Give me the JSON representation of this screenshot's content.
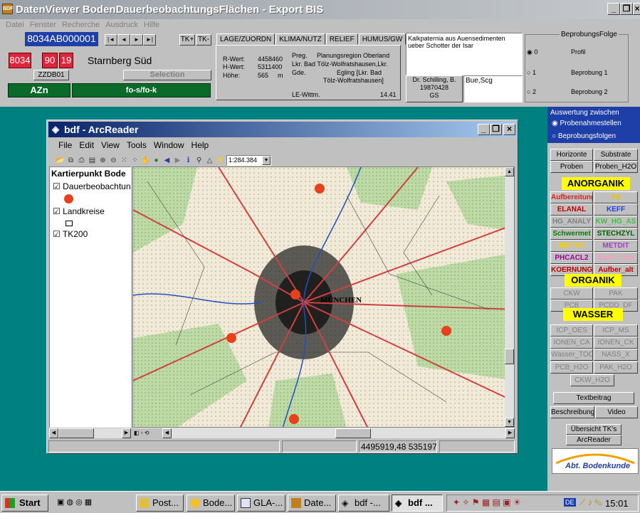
{
  "app": {
    "title": "DatenViewer BodenDauerbeobachtungsFlächen - Export BIS",
    "menu": [
      "Datei",
      "Fenster",
      "Recherche",
      "Ausdruck",
      "Hilfe"
    ]
  },
  "record": {
    "id": "8034AB000001",
    "nav_buttons": [
      "|◄",
      "◄",
      "►",
      "►|"
    ],
    "tk_plus": "TK+",
    "tk_minus": "TK-",
    "code1": "8034",
    "code2": "90",
    "code3": "19",
    "name": "Starnberg Süd",
    "zzdb": "ZZDB01",
    "selection_label": "Selection",
    "azn_label": "AZn",
    "fo_label": "fo-s/fo-k"
  },
  "tabs": [
    "LAGE/ZUORDN",
    "KLIMA/NUTZ",
    "RELIEF",
    "HUMUS/GW"
  ],
  "lage": {
    "rwert_label": "R-Wert:",
    "rwert": "4458460",
    "hwert_label": "H-Wert:",
    "hwert": "5311400",
    "hoehe_label": "Höhe:",
    "hoehe": "565",
    "hoehe_unit": "m",
    "preg_label": "Preg.",
    "preg": "Planungsregion Oberland",
    "lkr_label": "Lkr.",
    "lkr": "Bad Tölz-Wolfratshausen,Lkr.",
    "gde_label": "Gde.",
    "gde_line1": "Egling [Lkr. Bad",
    "gde_line2": "Tölz-Wolfratshausen]",
    "lewittm_label": "LE-Wittm.",
    "lewittm": "14.41"
  },
  "note": {
    "text": "Kalkpaternia aus Auensedimenten ueber Schotter der Isar",
    "person": "Dr. Schilling, B.",
    "date": "19870428",
    "gs": "GS",
    "abbr": "Bue,Scg"
  },
  "beprobung": {
    "group_label": "BeprobungsFolge",
    "options": [
      {
        "radio": "0",
        "label": "Profil",
        "selected": true
      },
      {
        "radio": "1",
        "label": "Beprobung 1",
        "selected": false
      },
      {
        "radio": "2",
        "label": "Beprobung 2",
        "selected": false
      }
    ]
  },
  "arcreader": {
    "title": "bdf - ArcReader",
    "menu": [
      "File",
      "Edit",
      "View",
      "Tools",
      "Window",
      "Help"
    ],
    "scale": "1:284.384",
    "toc_title": "Kartierpunkt Bode",
    "layers": [
      {
        "label": "Dauerbeobachtun",
        "checked": true
      },
      {
        "label": "Landkreise",
        "checked": true
      },
      {
        "label": "TK200",
        "checked": true
      }
    ],
    "map_label": "MÜNCHEN",
    "coords": "4495919,48  535197",
    "points_color": "#e8401c"
  },
  "auswertung": {
    "group_label": "Auswertung zwischen",
    "options": [
      {
        "label": "Probenahmestellen",
        "selected": true
      },
      {
        "label": "Beprobungsfolgen",
        "selected": false
      }
    ]
  },
  "right": {
    "row1": [
      "Horizonte",
      "Substrate"
    ],
    "row2": [
      "Proben",
      "Proben_H2O"
    ],
    "anorganik": "ANORGANIK",
    "anorg_buttons": [
      {
        "label": "Aufbereitung",
        "color": "#e02020"
      },
      {
        "label": "AS",
        "color": "#f0c000"
      },
      {
        "label": "ELANAL",
        "color": "#c00000"
      },
      {
        "label": "KEFF",
        "color": "#2040e0"
      },
      {
        "label": "HG_ANALY",
        "color": "#808080"
      },
      {
        "label": "KW_HG_AS",
        "color": "#40c040"
      },
      {
        "label": "Schwermet",
        "color": "#008000"
      },
      {
        "label": "STECHZYL",
        "color": "#006000"
      },
      {
        "label": "METOX",
        "color": "#f0d000"
      },
      {
        "label": "METDIT",
        "color": "#a040c0"
      },
      {
        "label": "PHCACL2",
        "color": "#a000a0"
      },
      {
        "label": "Radio_Nuk",
        "color": "#f0a0c0"
      },
      {
        "label": "KOERNUNG",
        "color": "#c00000"
      },
      {
        "label": "Aufber_alt",
        "color": "#c00000"
      }
    ],
    "organik": "ORGANIK",
    "org_buttons": [
      "CKW",
      "PAK",
      "PCB",
      "PCDD_DF"
    ],
    "wasser": "WASSER",
    "wasser_buttons": [
      "ICP_OES",
      "ICP_MS",
      "IONEN_CA",
      "IONEN_CK",
      "Wasser_TOC",
      "NASS_X"
    ],
    "h2o_buttons": [
      "PCB_H2O",
      "PAK_H2O"
    ],
    "ckw_h2o": "CKW_H2O",
    "textbeitrag": "Textbeitrag",
    "beschreibung": "Beschreibung",
    "video": "Video",
    "uebersicht": "Übersicht TK's",
    "arcreader": "ArcReader",
    "logo_text": "Abt. Bodenkunde"
  },
  "taskbar": {
    "start": "Start",
    "tasks": [
      "Post...",
      "Bode...",
      "GLA-...",
      "Date...",
      "bdf -...",
      "bdf ..."
    ],
    "clock": "15:01",
    "lang": "DE"
  }
}
